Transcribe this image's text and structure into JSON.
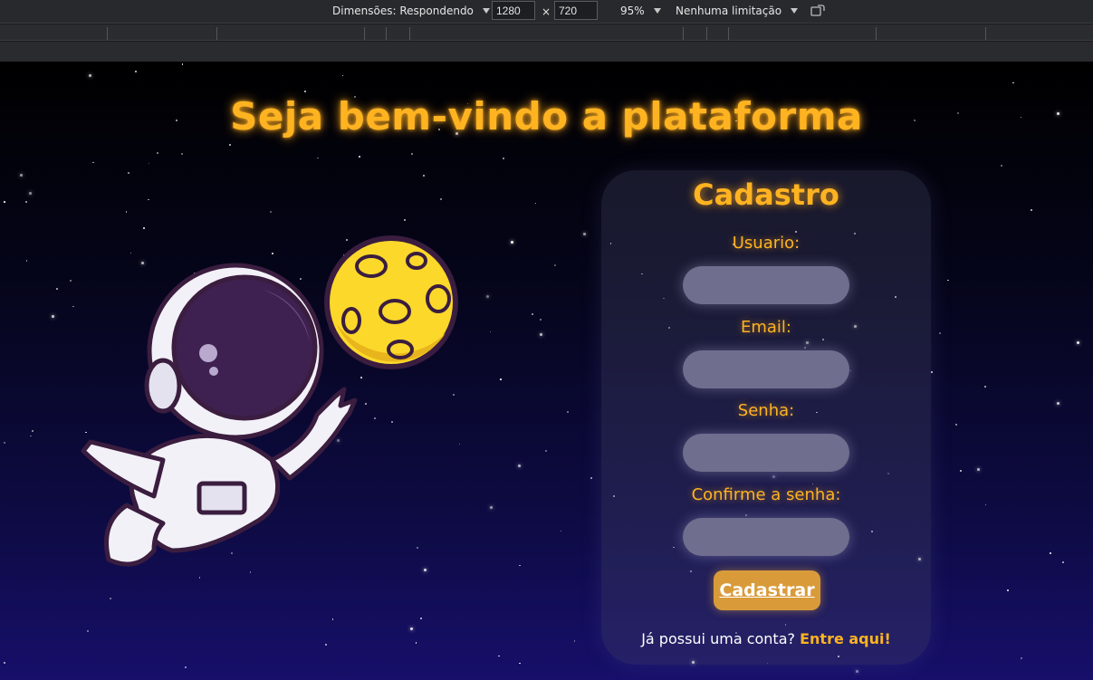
{
  "devtools": {
    "dimensions_label": "Dimensões: Respondendo",
    "width": "1280",
    "height": "720",
    "times": "×",
    "zoom": "95%",
    "throttle": "Nenhuma limitação",
    "rotate_icon": "rotate-icon"
  },
  "page": {
    "headline": "Seja bem-vindo a plataforma",
    "card": {
      "title": "Cadastro",
      "fields": [
        {
          "label": "Usuario:",
          "value": ""
        },
        {
          "label": "Email:",
          "value": ""
        },
        {
          "label": "Senha:",
          "value": ""
        },
        {
          "label": "Confirme a senha:",
          "value": ""
        }
      ],
      "submit_label": "Cadastrar",
      "footer_text": "Já possui uma conta?",
      "footer_link": "Entre aqui!"
    },
    "illustration": "astronaut-moon-illustration"
  },
  "colors": {
    "accent": "#ffb321",
    "button": "#d99b3a",
    "input": "#6f6e8e",
    "bg_top": "#000000",
    "bg_bottom": "#170f6a"
  }
}
